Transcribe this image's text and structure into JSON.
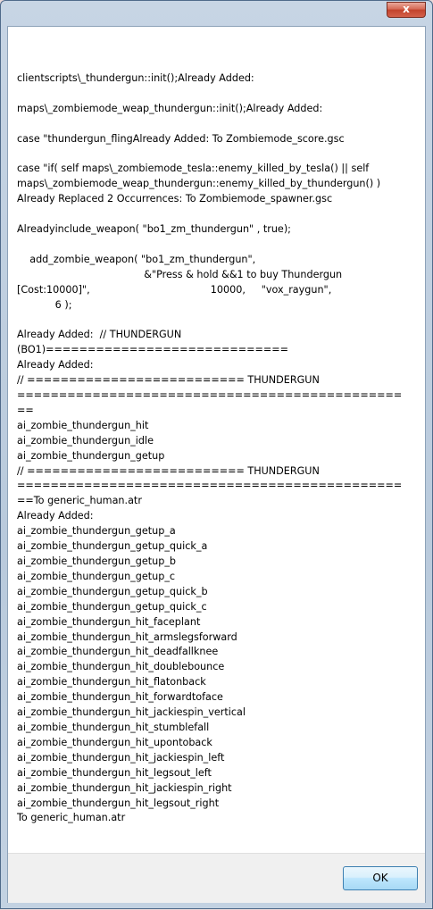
{
  "window": {
    "close_glyph": "x"
  },
  "dialog": {
    "message_lines": [
      "clientscripts\\_thundergun::init();Already Added:",
      "",
      "maps\\_zombiemode_weap_thundergun::init();Already Added:",
      "",
      "case \"thundergun_flingAlready Added: To Zombiemode_score.gsc",
      "",
      "case \"if( self maps\\_zombiemode_tesla::enemy_killed_by_tesla() || self",
      "maps\\_zombiemode_weap_thundergun::enemy_killed_by_thundergun() )",
      "Already Replaced 2 Occurrences: To Zombiemode_spawner.gsc",
      "",
      "Alreadyinclude_weapon( \"bo1_zm_thundergun\" , true);",
      "",
      "    add_zombie_weapon( \"bo1_zm_thundergun\",",
      "                                        &\"Press & hold &&1 to buy Thundergun",
      "[Cost:10000]\",                                      10000,     \"vox_raygun\",",
      "            6 );",
      "",
      "Already Added:  // THUNDERGUN",
      "(BO1)=============================",
      "Already Added:",
      "// ========================== THUNDERGUN",
      "==============================================",
      "==",
      "ai_zombie_thundergun_hit",
      "ai_zombie_thundergun_idle",
      "ai_zombie_thundergun_getup",
      "// ========================== THUNDERGUN",
      "==============================================",
      "==To generic_human.atr",
      "Already Added:",
      "ai_zombie_thundergun_getup_a",
      "ai_zombie_thundergun_getup_quick_a",
      "ai_zombie_thundergun_getup_b",
      "ai_zombie_thundergun_getup_c",
      "ai_zombie_thundergun_getup_quick_b",
      "ai_zombie_thundergun_getup_quick_c",
      "ai_zombie_thundergun_hit_faceplant",
      "ai_zombie_thundergun_hit_armslegsforward",
      "ai_zombie_thundergun_hit_deadfallknee",
      "ai_zombie_thundergun_hit_doublebounce",
      "ai_zombie_thundergun_hit_flatonback",
      "ai_zombie_thundergun_hit_forwardtoface",
      "ai_zombie_thundergun_hit_jackiespin_vertical",
      "ai_zombie_thundergun_hit_stumblefall",
      "ai_zombie_thundergun_hit_upontoback",
      "ai_zombie_thundergun_hit_jackiespin_left",
      "ai_zombie_thundergun_hit_legsout_left",
      "ai_zombie_thundergun_hit_jackiespin_right",
      "ai_zombie_thundergun_hit_legsout_right",
      "To generic_human.atr"
    ],
    "ok_label": "OK"
  }
}
